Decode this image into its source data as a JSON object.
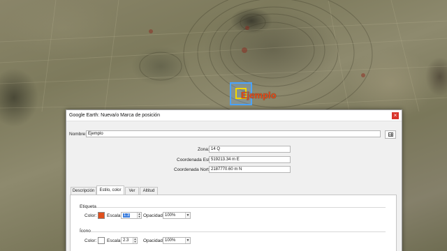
{
  "placemark": {
    "label": "Ejemplo"
  },
  "dialog": {
    "title": "Google Earth: Nueva/o Marca de posición",
    "close_glyph": "×",
    "name_label": "Nombre:",
    "name_value": "Ejemplo",
    "zone_label": "Zona:",
    "zone_value": "14 Q",
    "east_label": "Coordenada Este:",
    "east_value": "519213.34 m E",
    "north_label": "Coordenada Norte:",
    "north_value": "2187770.60 m N",
    "tabs": [
      {
        "label": "Descripción"
      },
      {
        "label": "Estilo, color"
      },
      {
        "label": "Ver"
      },
      {
        "label": "Altitud"
      }
    ],
    "label_section": {
      "title": "Etiqueta",
      "color_label": "Color:",
      "color": "#e0501e",
      "scale_label": "Escala:",
      "scale_value": "1.3",
      "opacity_label": "Opacidad:",
      "opacity_value": "100%"
    },
    "icon_section": {
      "title": "Ícono",
      "color_label": "Color:",
      "color": "#ffffff",
      "scale_label": "Escala:",
      "scale_value": "2.3",
      "opacity_label": "Opacidad:",
      "opacity_value": "100%"
    }
  }
}
